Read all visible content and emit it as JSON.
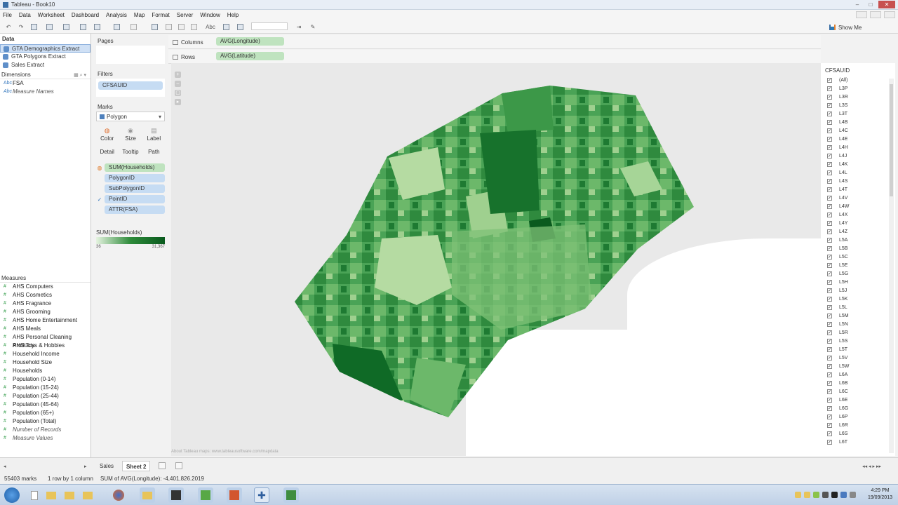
{
  "window": {
    "title": "Tableau - Book10"
  },
  "menu": [
    "File",
    "Data",
    "Worksheet",
    "Dashboard",
    "Analysis",
    "Map",
    "Format",
    "Server",
    "Window",
    "Help"
  ],
  "toolbar": {
    "abc_label": "Abc",
    "show_me_label": "Show Me"
  },
  "data_pane": {
    "title": "Data",
    "sources": [
      {
        "label": "GTA Demographics Extract",
        "selected": true
      },
      {
        "label": "GTA Polygons Extract",
        "selected": false
      },
      {
        "label": "Sales Extract",
        "selected": false
      }
    ],
    "dimensions_label": "Dimensions",
    "dimensions": [
      {
        "label": "FSA",
        "type": "Abc"
      },
      {
        "label": "Measure Names",
        "type": "Abc",
        "italic": true
      }
    ],
    "measures_label": "Measures",
    "measures": [
      {
        "label": "AHS Computers"
      },
      {
        "label": "AHS Cosmetics"
      },
      {
        "label": "AHS Fragrance"
      },
      {
        "label": "AHS Grooming"
      },
      {
        "label": "AHS Home Entertainment"
      },
      {
        "label": "AHS Meals"
      },
      {
        "label": "AHS Personal Cleaning Products"
      },
      {
        "label": "AHS Toys & Hobbies"
      },
      {
        "label": "Household Income"
      },
      {
        "label": "Household Size"
      },
      {
        "label": "Households"
      },
      {
        "label": "Population (0-14)"
      },
      {
        "label": "Population (15-24)"
      },
      {
        "label": "Population (25-44)"
      },
      {
        "label": "Population (45-64)"
      },
      {
        "label": "Population (65+)"
      },
      {
        "label": "Population (Total)"
      },
      {
        "label": "Number of Records",
        "italic": true
      },
      {
        "label": "Measure Values",
        "italic": true
      }
    ]
  },
  "shelves": {
    "pages_label": "Pages",
    "filters_label": "Filters",
    "filter_pill": "CFSAUID",
    "marks_label": "Marks",
    "mark_type": "Polygon",
    "mark_buttons": [
      "Color",
      "Size",
      "Label",
      "Detail",
      "Tooltip",
      "Path"
    ],
    "mark_pills": [
      {
        "label": "SUM(Households)",
        "kind": "color",
        "color": "green"
      },
      {
        "label": "PolygonID",
        "kind": "detail",
        "color": "blue"
      },
      {
        "label": "SubPolygonID",
        "kind": "detail",
        "color": "blue"
      },
      {
        "label": "PointID",
        "kind": "path",
        "color": "blue"
      },
      {
        "label": "ATTR(FSA)",
        "kind": "detail",
        "color": "blue"
      }
    ],
    "legend": {
      "title": "SUM(Households)",
      "min": "36",
      "max": "31,367"
    }
  },
  "columns": {
    "label": "Columns",
    "pill": "AVG(Longitude)"
  },
  "rows": {
    "label": "Rows",
    "pill": "AVG(Latitude)"
  },
  "map": {
    "attribution": "About Tableau maps: www.tableausoftware.com/mapdata"
  },
  "filter_card": {
    "title": "CFSAUID",
    "items": [
      "(All)",
      "L3P",
      "L3R",
      "L3S",
      "L3T",
      "L4B",
      "L4C",
      "L4E",
      "L4H",
      "L4J",
      "L4K",
      "L4L",
      "L4S",
      "L4T",
      "L4V",
      "L4W",
      "L4X",
      "L4Y",
      "L4Z",
      "L5A",
      "L5B",
      "L5C",
      "L5E",
      "L5G",
      "L5H",
      "L5J",
      "L5K",
      "L5L",
      "L5M",
      "L5N",
      "L5R",
      "L5S",
      "L5T",
      "L5V",
      "L5W",
      "L6A",
      "L6B",
      "L6C",
      "L6E",
      "L6G",
      "L6P",
      "L6R",
      "L6S",
      "L6T"
    ]
  },
  "tabs": {
    "items": [
      "Sales",
      "Sheet 2"
    ],
    "active": "Sheet 2"
  },
  "status": {
    "marks": "55403 marks",
    "dims": "1 row by 1 column",
    "sum": "SUM of AVG(Longitude): -4,401,826.2019"
  },
  "clock": {
    "time": "4:29 PM",
    "date": "19/09/2013"
  }
}
